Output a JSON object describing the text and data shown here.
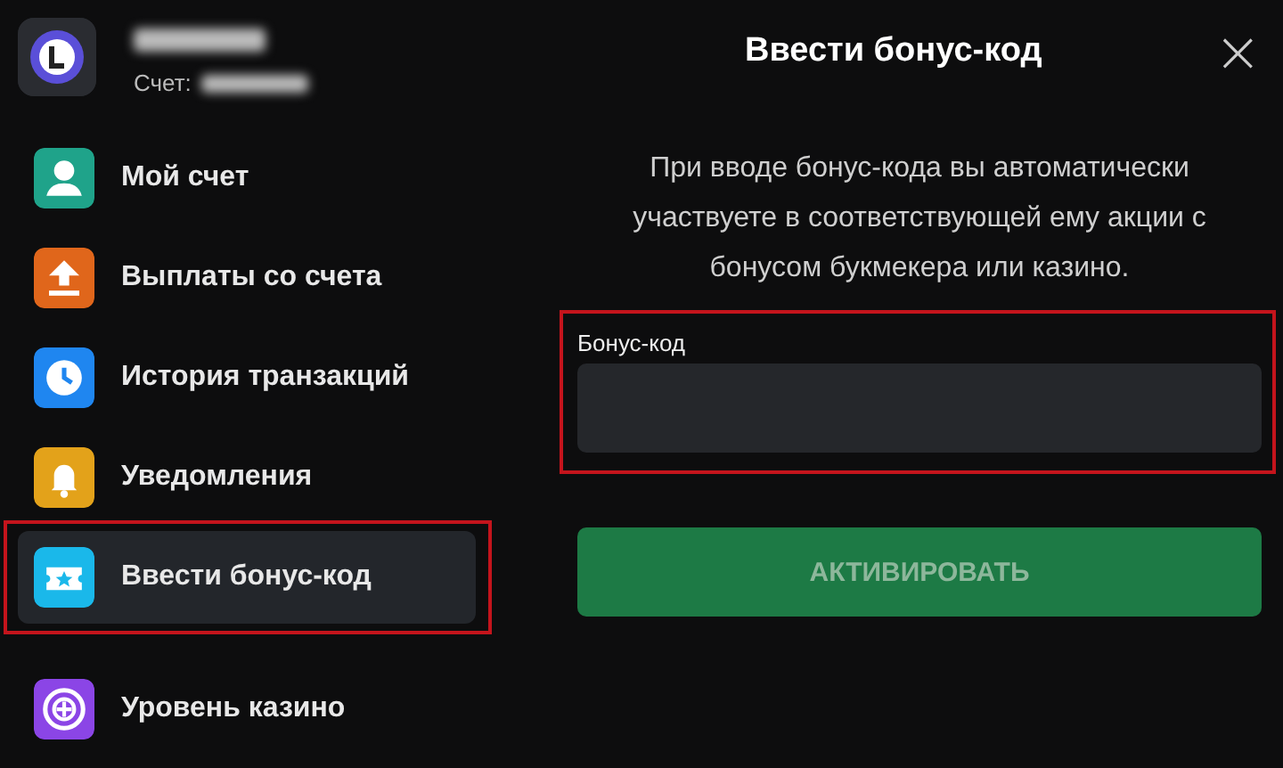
{
  "account": {
    "label": "Счет:"
  },
  "menu": [
    {
      "kind": "person",
      "label": "Мой счет",
      "color": "#1fa38a",
      "selected": false,
      "highlighted": false
    },
    {
      "kind": "upload",
      "label": "Выплаты со счета",
      "color": "#e0661b",
      "selected": false,
      "highlighted": false
    },
    {
      "kind": "clock",
      "label": "История транзакций",
      "color": "#1f86f0",
      "selected": false,
      "highlighted": false
    },
    {
      "kind": "bell",
      "label": "Уведомления",
      "color": "#e3a21a",
      "selected": false,
      "highlighted": false
    },
    {
      "kind": "ticket",
      "label": "Ввести бонус-код",
      "color": "#1ab8ea",
      "selected": true,
      "highlighted": true
    },
    {
      "kind": "roulette",
      "label": "Уровень казино",
      "color": "#8b45e6",
      "selected": false,
      "highlighted": false
    }
  ],
  "dialog": {
    "title": "Ввести бонус-код",
    "close": "×",
    "description": "При вводе бонус-кода вы автоматически участвуете в соответствующей ему акции с бонусом букмекера или казино.",
    "field": {
      "label": "Бонус-код",
      "highlighted": true
    },
    "button": {
      "label": "АКТИВИРОВАТЬ",
      "disabled": true
    }
  }
}
